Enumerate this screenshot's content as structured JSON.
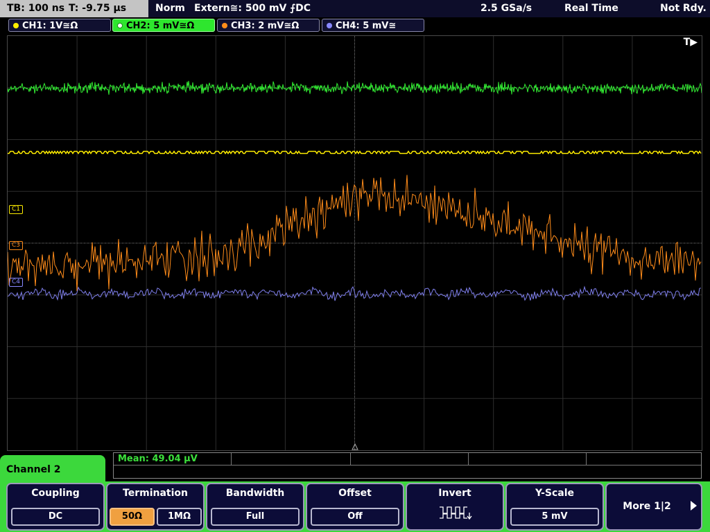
{
  "status": {
    "timebase": "TB: 100 ns",
    "trigger_time": "T: -9.75 µs",
    "mode": "Norm",
    "trigger": "Extern≅: 500 mV ⨍DC",
    "sample_rate": "2.5 GSa/s",
    "acquisition": "Real Time",
    "state": "Not Rdy."
  },
  "channels": [
    {
      "label": "CH1: 1V≅Ω",
      "color": "#ffee00"
    },
    {
      "label": "CH2: 5 mV≅Ω",
      "color": "#33ee33"
    },
    {
      "label": "CH3: 2 mV≅Ω",
      "color": "#ff8c1a"
    },
    {
      "label": "CH4: 5 mV≅",
      "color": "#8888ff"
    }
  ],
  "display": {
    "trigger_marker": "T▶",
    "channel_markers": [
      "C1",
      "C3",
      "C4"
    ]
  },
  "measurement": {
    "label": "Mean: 49.04 µV"
  },
  "menu": {
    "title": "Channel 2",
    "coupling": {
      "title": "Coupling",
      "value": "DC"
    },
    "termination": {
      "title": "Termination",
      "options": [
        "50Ω",
        "1MΩ"
      ],
      "selected": "50Ω"
    },
    "bandwidth": {
      "title": "Bandwidth",
      "value": "Full"
    },
    "offset": {
      "title": "Offset",
      "value": "Off"
    },
    "invert": {
      "title": "Invert",
      "icon": "inverted-pulse-icon"
    },
    "yscale": {
      "title": "Y-Scale",
      "value": "5 mV"
    },
    "more": {
      "label": "More 1|2"
    }
  },
  "colors": {
    "ch1": "#ffee00",
    "ch2": "#33ee33",
    "ch3": "#ff8c1a",
    "ch4": "#8888ff",
    "softkey_bg": "#0c0c38",
    "menu_accent": "#3cd83c",
    "selected": "#f0a040"
  }
}
